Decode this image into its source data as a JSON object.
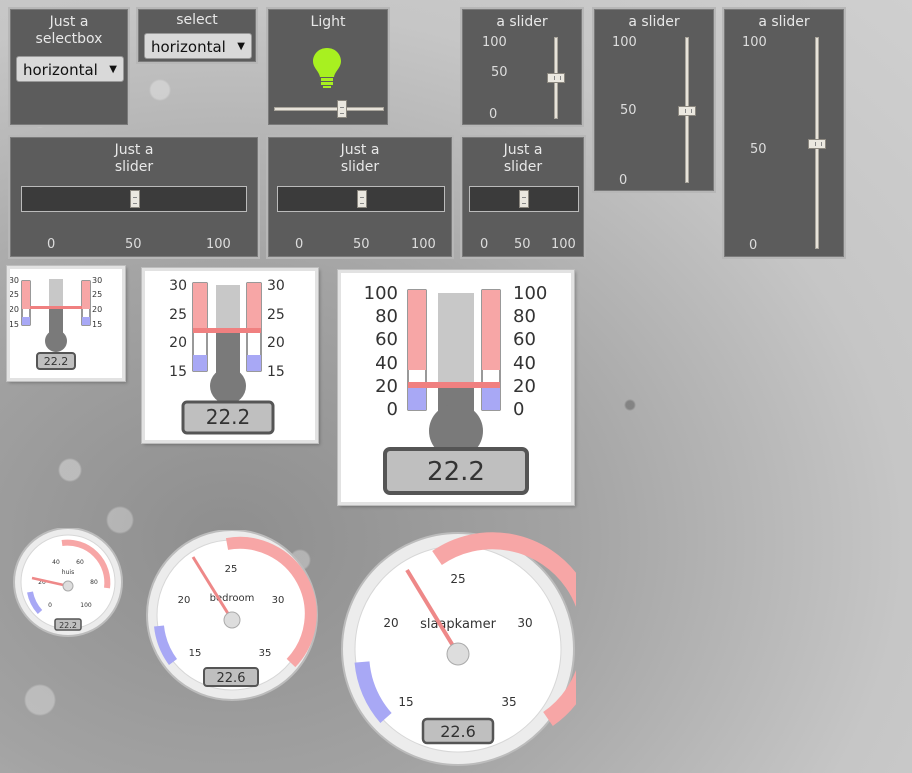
{
  "selects": [
    {
      "title": "Just a selectbox",
      "value": "horizontal"
    },
    {
      "title": "select",
      "value": "horizontal"
    }
  ],
  "light": {
    "title": "Light",
    "icon": "lightbulb-icon",
    "color": "#a8f020",
    "level": 0.6
  },
  "vsliders": [
    {
      "title": "a slider",
      "ticks": [
        "100",
        "50",
        "0"
      ],
      "value": 50
    },
    {
      "title": "a slider",
      "ticks": [
        "100",
        "50",
        "0"
      ],
      "value": 50
    },
    {
      "title": "a slider",
      "ticks": [
        "100",
        "50",
        "0"
      ],
      "value": 50
    }
  ],
  "hsliders": [
    {
      "title_line1": "Just a",
      "title_line2": "slider",
      "ticks": [
        "0",
        "50",
        "100"
      ],
      "value": 50
    },
    {
      "title_line1": "Just a",
      "title_line2": "slider",
      "ticks": [
        "0",
        "50",
        "100"
      ],
      "value": 50
    },
    {
      "title_line1": "Just a",
      "title_line2": "slider",
      "ticks": [
        "0",
        "50",
        "100"
      ],
      "value": 50
    }
  ],
  "thermometers": [
    {
      "ticks": [
        "30",
        "25",
        "20",
        "15"
      ],
      "readout": "22.2"
    },
    {
      "ticks": [
        "30",
        "25",
        "20",
        "15"
      ],
      "readout": "22.2"
    },
    {
      "ticks": [
        "100",
        "80",
        "60",
        "40",
        "20",
        "0"
      ],
      "readout": "22.2"
    }
  ],
  "gauges": [
    {
      "label": "huis",
      "ticks": [
        "20",
        "40",
        "60",
        "80",
        "0",
        "100"
      ],
      "readout": "22.2"
    },
    {
      "label": "bedroom",
      "ticks": [
        "25",
        "20",
        "30",
        "15",
        "35"
      ],
      "readout": "22.6"
    },
    {
      "label": "slaapkamer",
      "ticks": [
        "25",
        "20",
        "30",
        "15",
        "35"
      ],
      "readout": "22.6"
    }
  ]
}
